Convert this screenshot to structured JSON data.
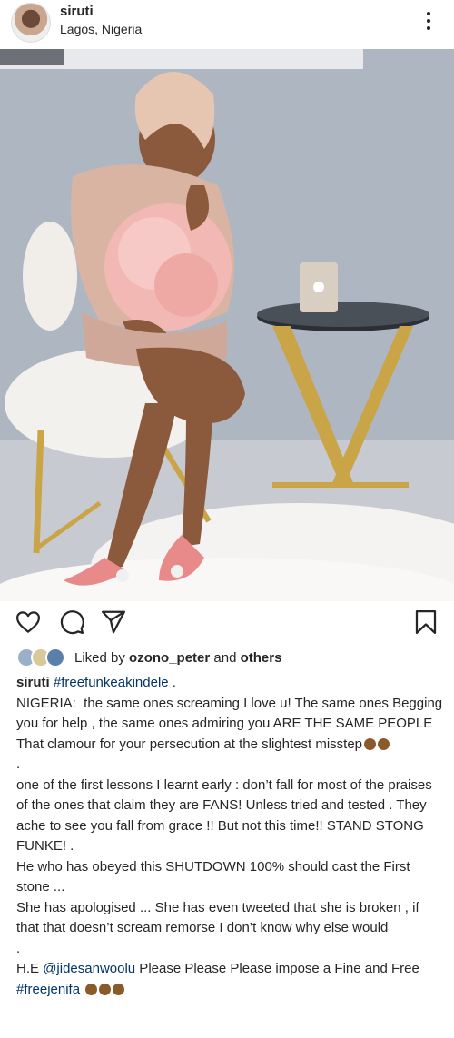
{
  "post": {
    "username": "siruti",
    "location": "Lagos, Nigeria"
  },
  "likes": {
    "prefix": "Liked by ",
    "user": "ozono_peter",
    "joiner": " and ",
    "others": "others"
  },
  "caption": {
    "username": "siruti",
    "hashtag": "#freefunkeakindele",
    "after_hashtag": " .",
    "p1": "NIGERIA:  the same ones screaming I love u! The same ones Begging you for help , the same ones admiring you ARE THE SAME PEOPLE That clamour for your persecution at the slightest misstep",
    "dot1": ".",
    "p2": "one of the first lessons I learnt early : don’t fall for most of the praises of the ones that claim they are FANS! Unless tried and tested . They ache to see you fall from grace !! But not this time!! STAND STONG FUNKE! .\nHe who has obeyed this SHUTDOWN 100% should cast the First stone ...\nShe has apologised ... She has even tweeted that she is broken , if that that doesn’t scream remorse I don’t know why else would",
    "dot2": ".",
    "p3_prefix": "H.E ",
    "mention": "@jidesanwoolu",
    "p3_mid": " Please Please Please impose a Fine and Free  ",
    "hashtag2": "#freejenifa"
  },
  "icons": {
    "more": "more-vertical-icon",
    "like": "heart-icon",
    "comment": "comment-icon",
    "share": "send-icon",
    "save": "bookmark-icon",
    "emoji": "woman-facepalming-emoji"
  }
}
